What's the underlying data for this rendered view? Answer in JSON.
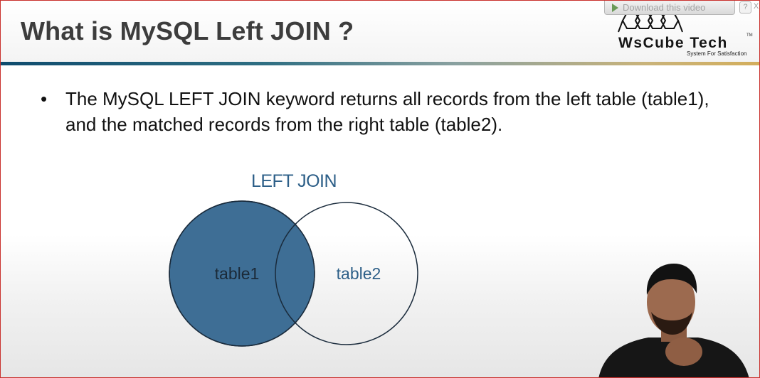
{
  "slide": {
    "title": "What is MySQL Left JOIN ?",
    "bullet": "The MySQL LEFT JOIN keyword returns all records from the left table (table1), and the matched records from the right table (table2)."
  },
  "download_bar": {
    "label": "Download this video",
    "help": "?",
    "close": "X"
  },
  "logo": {
    "wordmark": "WsCube Tech",
    "tm": "TM",
    "tagline": "System For Satisfaction"
  },
  "diagram": {
    "heading": "LEFT JOIN",
    "left_label": "table1",
    "right_label": "table2",
    "fill_color": "#3e6e95",
    "stroke_color": "#1a2b3c",
    "right_text_color": "#2d5f88"
  },
  "colors": {
    "title": "#3d3d3d",
    "frame_border": "#c9302c"
  }
}
